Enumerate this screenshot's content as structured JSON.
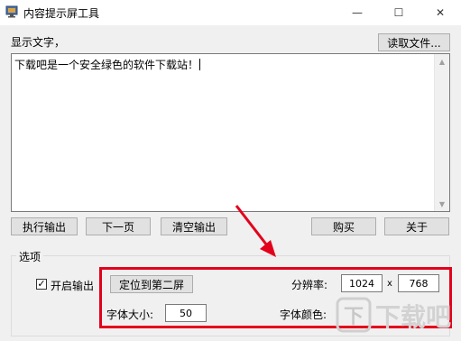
{
  "window": {
    "title": "内容提示屏工具",
    "controls": {
      "minimize": "—",
      "maximize": "☐",
      "close": "✕"
    }
  },
  "display": {
    "label": "显示文字，",
    "read_file_button": "读取文件...",
    "text": "下载吧是一个安全绿色的软件下载站！"
  },
  "actions": {
    "execute": "执行输出",
    "next_page": "下一页",
    "clear": "清空输出",
    "buy": "购买",
    "about": "关于"
  },
  "options": {
    "group_title": "选项",
    "enable_output_label": "开启输出",
    "enable_output_checked": true,
    "check_mark": "✓",
    "locate_button": "定位到第二屏",
    "resolution_label": "分辨率:",
    "resolution_width": "1024",
    "resolution_sep": "x",
    "resolution_height": "768",
    "font_size_label": "字体大小:",
    "font_size_value": "50",
    "font_color_label": "字体颜色:"
  },
  "colors": {
    "highlight": "#e3001b"
  },
  "watermark": {
    "text": "下载吧"
  }
}
